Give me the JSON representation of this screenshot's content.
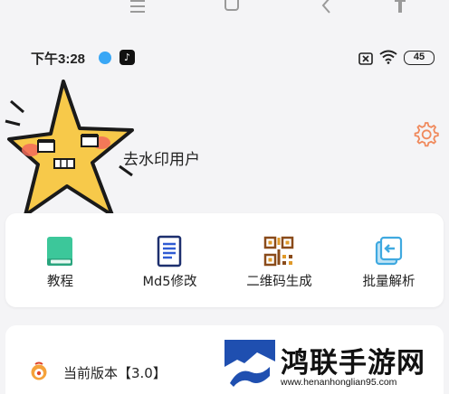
{
  "status_bar": {
    "time": "下午3:28",
    "battery": "45",
    "tiktok_glyph": "♪"
  },
  "profile": {
    "username": "去水印用户"
  },
  "tools": [
    {
      "label": "教程",
      "icon": "book-icon",
      "color": "#3cc79a"
    },
    {
      "label": "Md5修改",
      "icon": "document-icon",
      "color": "#2f5bd3"
    },
    {
      "label": "二维码生成",
      "icon": "qrcode-icon",
      "color": "#e09a2a"
    },
    {
      "label": "批量解析",
      "icon": "batch-export-icon",
      "color": "#3fa9e0"
    }
  ],
  "version": {
    "text": "当前版本【3.0】"
  },
  "watermark": {
    "title": "鸿联手游网",
    "url": "www.henanhonglian95.com"
  },
  "colors": {
    "background": "#f4f4f6",
    "card": "#ffffff",
    "settings_accent": "#f08a5d",
    "star_fill": "#f7c94a"
  }
}
